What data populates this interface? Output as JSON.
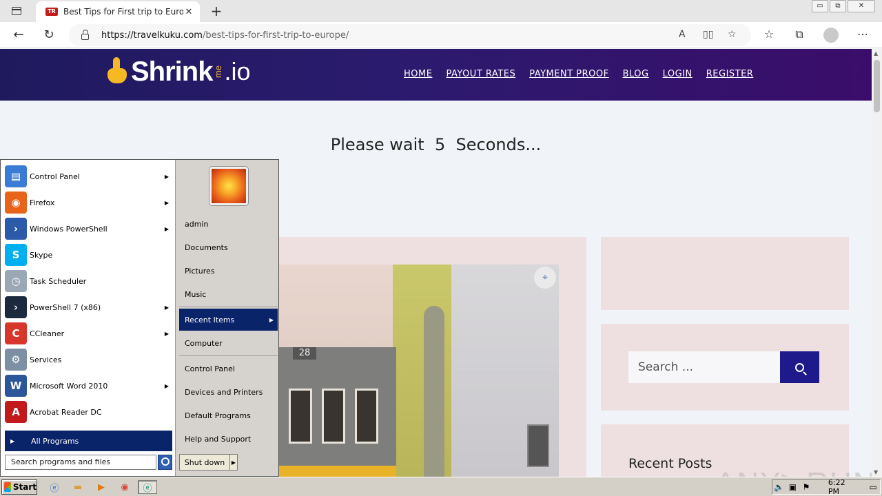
{
  "browser": {
    "tab_title": "Best Tips for First trip to Europe",
    "tab_favicon_text": "TR",
    "tab_close": "✕",
    "new_tab": "+",
    "url_domain": "https://travelkuku.com",
    "url_path": "/best-tips-for-first-trip-to-europe/",
    "back": "←",
    "reload": "↻",
    "read_aloud": "A",
    "win_min": "▭",
    "win_max": "⧉",
    "win_close": "✕"
  },
  "site": {
    "logo_word": "Shrink",
    "logo_me": "me",
    "logo_io": ".io",
    "nav": [
      "HOME",
      "PAYOUT RATES",
      "PAYMENT PROOF",
      "BLOG",
      "LOGIN",
      "REGISTER"
    ],
    "wait_text": "Please wait  5  Seconds...",
    "tram_number": "28",
    "search_placeholder": "Search ...",
    "recent_posts": "Recent Posts",
    "watermark": "ANY▷RUN"
  },
  "start_menu": {
    "left_items": [
      {
        "label": "Control Panel",
        "icon": "control-panel-icon",
        "color": "#3a7bd5",
        "glyph": "▤",
        "arrow": true
      },
      {
        "label": "Firefox",
        "icon": "firefox-icon",
        "color": "#e8641b",
        "glyph": "◉",
        "arrow": true
      },
      {
        "label": "Windows PowerShell",
        "icon": "powershell-icon",
        "color": "#2a5aa8",
        "glyph": "›",
        "arrow": true
      },
      {
        "label": "Skype",
        "icon": "skype-icon",
        "color": "#00aff0",
        "glyph": "S",
        "arrow": false
      },
      {
        "label": "Task Scheduler",
        "icon": "task-scheduler-icon",
        "color": "#9aa7b5",
        "glyph": "◷",
        "arrow": false
      },
      {
        "label": "PowerShell 7 (x86)",
        "icon": "powershell7-icon",
        "color": "#1b2a3f",
        "glyph": "›",
        "arrow": true
      },
      {
        "label": "CCleaner",
        "icon": "ccleaner-icon",
        "color": "#d8362a",
        "glyph": "C",
        "arrow": true
      },
      {
        "label": "Services",
        "icon": "services-icon",
        "color": "#7d8fa3",
        "glyph": "⚙",
        "arrow": false
      },
      {
        "label": "Microsoft Word 2010",
        "icon": "word-icon",
        "color": "#2b579a",
        "glyph": "W",
        "arrow": true
      },
      {
        "label": "Acrobat Reader DC",
        "icon": "acrobat-icon",
        "color": "#c21a1a",
        "glyph": "A",
        "arrow": false
      }
    ],
    "all_programs": "All Programs",
    "search_placeholder": "Search programs and files",
    "right_items": [
      "admin",
      "Documents",
      "Pictures",
      "Music",
      "Recent Items",
      "Computer",
      "Control Panel",
      "Devices and Printers",
      "Default Programs",
      "Help and Support"
    ],
    "shutdown": "Shut down"
  },
  "taskbar": {
    "start": "Start",
    "clock": "6:22 PM"
  }
}
